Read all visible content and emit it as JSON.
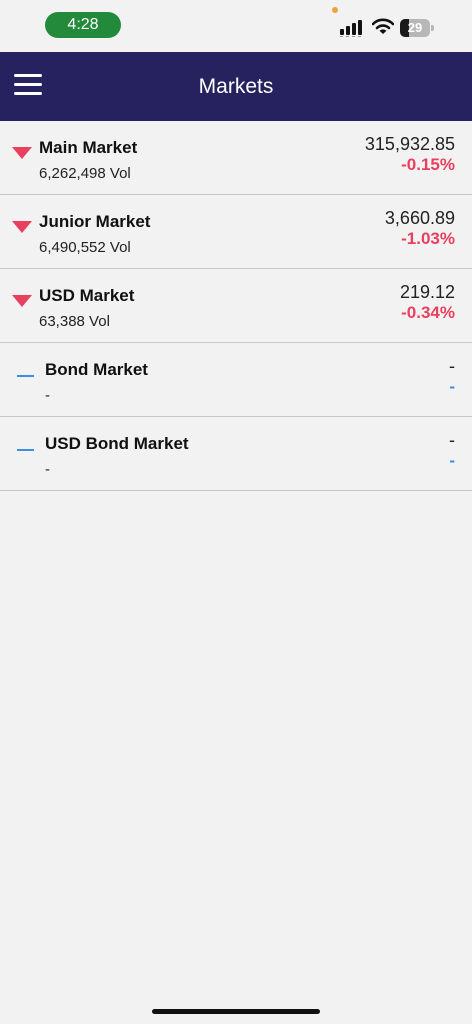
{
  "status_bar": {
    "time": "4:28",
    "battery_level": "29",
    "battery_fraction": 0.29,
    "icons": [
      "signal-icon",
      "wifi-icon",
      "battery-icon"
    ],
    "time_pill_color": "#238a3c"
  },
  "header": {
    "title": "Markets",
    "menu_icon": "hamburger-menu-icon",
    "background_color": "#26225f"
  },
  "markets": [
    {
      "name": "Main Market",
      "volume": "6,262,498 Vol",
      "value": "315,932.85",
      "change": "-0.15%",
      "trend": "down"
    },
    {
      "name": "Junior Market",
      "volume": "6,490,552 Vol",
      "value": "3,660.89",
      "change": "-1.03%",
      "trend": "down"
    },
    {
      "name": "USD Market",
      "volume": "63,388 Vol",
      "value": "219.12",
      "change": "-0.34%",
      "trend": "down"
    },
    {
      "name": "Bond Market",
      "volume": "-",
      "value": "-",
      "change": "-",
      "trend": "flat"
    },
    {
      "name": "USD Bond Market",
      "volume": "-",
      "value": "-",
      "change": "-",
      "trend": "flat"
    }
  ],
  "colors": {
    "down": "#e8405e",
    "flat": "#3b8fe0"
  }
}
